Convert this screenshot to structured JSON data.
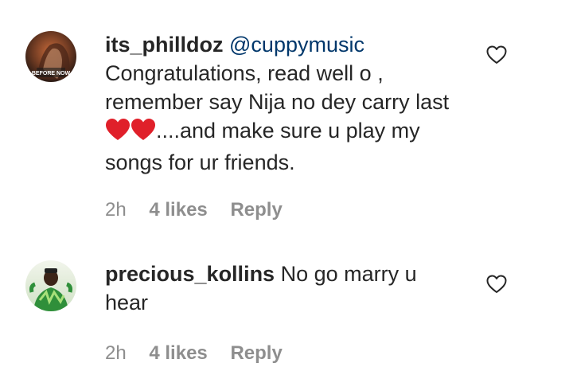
{
  "comments": [
    {
      "username": "its_philldoz",
      "mention": "@cuppymusic",
      "text_line1": "Congratulations, read well o ,",
      "text_line2": "remember say Nija no dey carry last",
      "emoji": "❤️❤️",
      "text_line3_rest": "....and make sure u play my",
      "text_line4": "songs for ur friends.",
      "time": "2h",
      "likes": "4 likes",
      "reply": "Reply",
      "avatar_text": "BEFORE NOW"
    },
    {
      "username": "precious_kollins",
      "text_line1": "No go marry u",
      "text_line2": "hear",
      "time": "2h",
      "likes": "4 likes",
      "reply": "Reply"
    }
  ],
  "colors": {
    "text": "#262626",
    "mention": "#00376b",
    "meta": "#8e8e8e",
    "heart_emoji": "#e0202a"
  },
  "icons": {
    "like": "heart-outline-icon",
    "emoji": "red-heart-emoji"
  }
}
